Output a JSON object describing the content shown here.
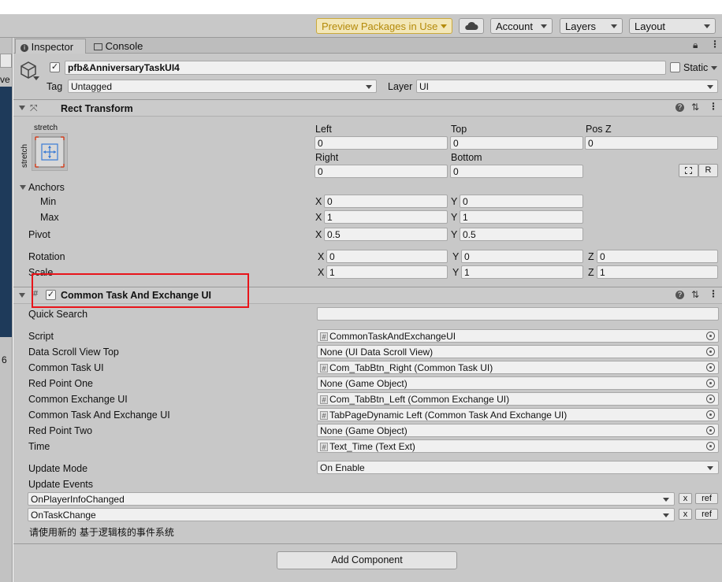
{
  "toolbar": {
    "preview_packages": "Preview Packages in Use",
    "account": "Account",
    "layers": "Layers",
    "layout": "Layout"
  },
  "left_strip": {
    "partial_text_top": "ve",
    "partial_text_bottom": "6"
  },
  "tabs": {
    "inspector": "Inspector",
    "console": "Console"
  },
  "gameobject": {
    "name": "pfb&AnniversaryTaskUI4",
    "static_label": "Static",
    "tag_label": "Tag",
    "tag_value": "Untagged",
    "layer_label": "Layer",
    "layer_value": "UI"
  },
  "rect_transform": {
    "title": "Rect Transform",
    "anchor_preset_top": "stretch",
    "anchor_preset_side": "stretch",
    "left_label": "Left",
    "left": "0",
    "top_label": "Top",
    "top": "0",
    "posz_label": "Pos Z",
    "posz": "0",
    "right_label": "Right",
    "right": "0",
    "bottom_label": "Bottom",
    "bottom": "0",
    "r_button": "R",
    "anchors_label": "Anchors",
    "min_label": "Min",
    "min_x": "0",
    "min_y": "0",
    "max_label": "Max",
    "max_x": "1",
    "max_y": "1",
    "pivot_label": "Pivot",
    "pivot_x": "0.5",
    "pivot_y": "0.5",
    "rotation_label": "Rotation",
    "rot_x": "0",
    "rot_y": "0",
    "rot_z": "0",
    "scale_label": "Scale",
    "scale_x": "1",
    "scale_y": "1",
    "scale_z": "1",
    "x": "X",
    "y": "Y",
    "z": "Z"
  },
  "component": {
    "title": "Common Task And Exchange UI",
    "quick_search_label": "Quick Search",
    "fields": [
      {
        "label": "Script",
        "value": "CommonTaskAndExchangeUI"
      },
      {
        "label": "Data Scroll View Top",
        "value": "None (UI Data Scroll View)"
      },
      {
        "label": "Common Task UI",
        "value": "Com_TabBtn_Right (Common Task UI)"
      },
      {
        "label": "Red Point One",
        "value": "None (Game Object)"
      },
      {
        "label": "Common Exchange UI",
        "value": "Com_TabBtn_Left (Common Exchange UI)"
      },
      {
        "label": "Common Task And Exchange UI",
        "value": "TabPageDynamic Left (Common Task And Exchange UI)"
      },
      {
        "label": "Red Point Two",
        "value": "None (Game Object)"
      },
      {
        "label": "Time",
        "value": "Text_Time (Text Ext)"
      }
    ],
    "update_mode_label": "Update Mode",
    "update_mode_value": "On Enable",
    "update_events_label": "Update Events",
    "events": [
      {
        "name": "OnPlayerInfoChanged",
        "x": "x",
        "ref": "ref"
      },
      {
        "name": "OnTaskChange",
        "x": "x",
        "ref": "ref"
      }
    ],
    "note": "请使用新的 基于逻辑核的事件系统"
  },
  "add_component": "Add Component",
  "colors": {
    "highlight_box": "#e8141a",
    "preview_accent": "#b48a0a"
  }
}
